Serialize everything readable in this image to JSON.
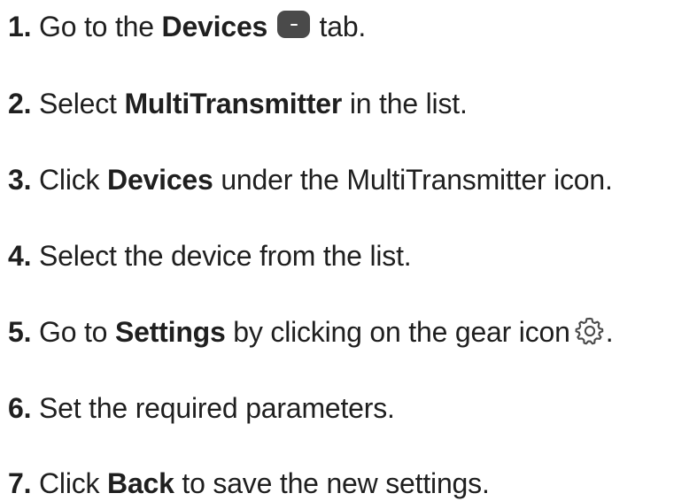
{
  "steps": [
    {
      "num": "1.",
      "parts": [
        "Go to the ",
        "Devices",
        " tab."
      ]
    },
    {
      "num": "2.",
      "parts": [
        "Select ",
        "MultiTransmitter",
        " in the list."
      ]
    },
    {
      "num": "3.",
      "parts": [
        "Click ",
        "Devices",
        " under the MultiTransmitter icon."
      ]
    },
    {
      "num": "4.",
      "parts": [
        "Select the device from the list."
      ]
    },
    {
      "num": "5.",
      "parts": [
        "Go to ",
        "Settings",
        " by clicking on the gear icon",
        "."
      ]
    },
    {
      "num": "6.",
      "parts": [
        "Set the required parameters."
      ]
    },
    {
      "num": "7.",
      "parts": [
        "Click ",
        "Back",
        " to save the new settings."
      ]
    }
  ],
  "icons": {
    "devices_tab": "devices-tab-icon",
    "settings": "gear-icon"
  },
  "colors": {
    "text": "#1f1f1f",
    "icon": "#4a4a4a"
  }
}
